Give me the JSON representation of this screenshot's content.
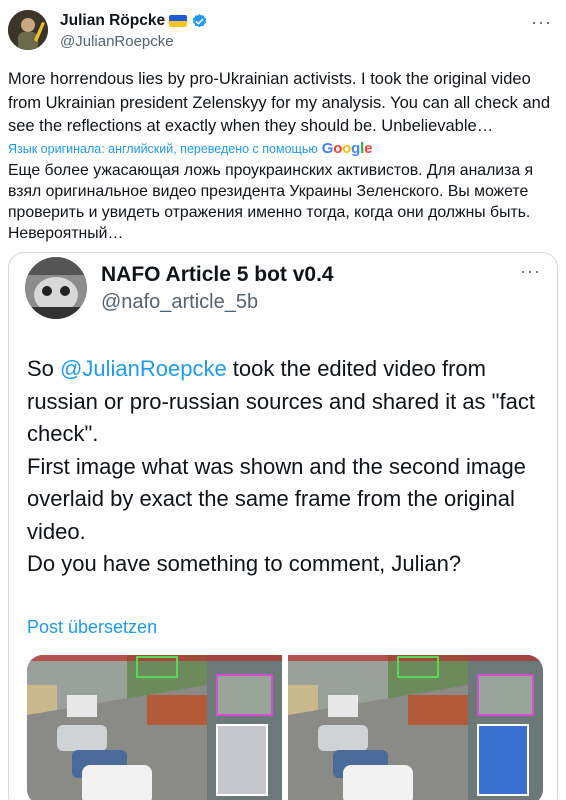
{
  "author": {
    "name": "Julian Röpcke",
    "handle": "@JulianRoepcke",
    "flag_icon": "ukraine-flag-icon",
    "verified_icon": "verified-badge-icon"
  },
  "post": {
    "text_en": "More horrendous lies by pro-Ukrainian activists. I took the original video from Ukrainian president Zelenskyy for my analysis. You can all check and see the reflections at exactly when they should be. Unbelievable…",
    "translation_note": "Язык оригинала: английский, переведено с помощью",
    "translation_provider": "Google",
    "text_ru": "Еще более ужасающая ложь проукраинских активистов. Для анализа я взял оригинальное видео президента Украины Зеленского. Вы можете проверить и увидеть отражения именно тогда, когда они должны быть. Невероятный…"
  },
  "quoted": {
    "name": "NAFO Article 5 bot v0.4",
    "handle": "@nafo_article_5b",
    "text_prefix": "So ",
    "mention": "@JulianRoepcke",
    "text_rest": " took the edited video from russian or pro-russian sources and shared it as \"fact check\".\nFirst image what was shown and the second image overlaid by exact the same frame from the original video.\nDo you have something to comment, Julian?",
    "translate_label": "Post übersetzen",
    "media_count": 2
  },
  "colors": {
    "link": "#1d9bf0",
    "secondary_text": "#536471",
    "border": "#cfd9de"
  }
}
